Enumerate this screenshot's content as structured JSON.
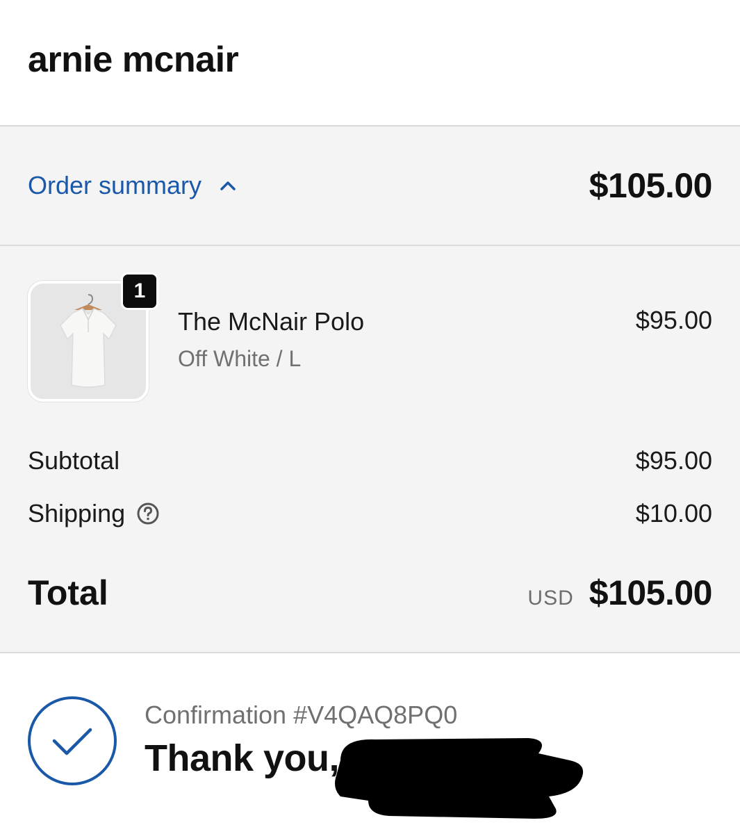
{
  "header": {
    "store_name": "arnie mcnair"
  },
  "summary": {
    "toggle_label": "Order summary",
    "toggle_icon": "chevron-up-icon",
    "total": "$105.00"
  },
  "line_item": {
    "quantity": "1",
    "name": "The McNair Polo",
    "variant": "Off White / L",
    "price": "$95.00",
    "image": "polo-shirt-image"
  },
  "costs": {
    "subtotal_label": "Subtotal",
    "subtotal_value": "$95.00",
    "shipping_label": "Shipping",
    "shipping_value": "$10.00",
    "shipping_help_icon": "question-circle-icon",
    "total_label": "Total",
    "currency": "USD",
    "total_value": "$105.00"
  },
  "confirmation": {
    "number_text": "Confirmation #V4QAQ8PQ0",
    "thank_you": "Thank you,"
  },
  "colors": {
    "accent": "#1a58a8",
    "panel_bg": "#f4f4f4",
    "divider": "#dcdcdc",
    "text": "#111111",
    "muted": "#707070"
  }
}
